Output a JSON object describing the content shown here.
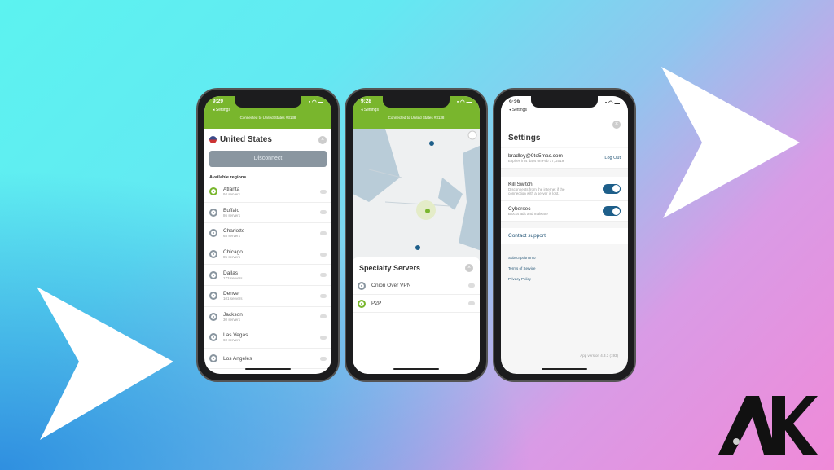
{
  "colors": {
    "accent_green": "#79b62d",
    "toggle_blue": "#1e5f8a",
    "arrow": "#ffffff"
  },
  "phone1": {
    "time": "9:29",
    "back": "◂ Settings",
    "connected": "Connected to United States #3138",
    "country": "United States",
    "flag_icon": "us-flag-icon",
    "disconnect": "Disconnect",
    "regions_title": "Available regions",
    "regions": [
      {
        "name": "Atlanta",
        "servers": "94 servers",
        "active": true
      },
      {
        "name": "Buffalo",
        "servers": "86 servers"
      },
      {
        "name": "Charlotte",
        "servers": "68 servers"
      },
      {
        "name": "Chicago",
        "servers": "85 servers"
      },
      {
        "name": "Dallas",
        "servers": "173 servers"
      },
      {
        "name": "Denver",
        "servers": "101 servers"
      },
      {
        "name": "Jackson",
        "servers": "30 servers"
      },
      {
        "name": "Las Vegas",
        "servers": "60 servers"
      },
      {
        "name": "Los Angeles",
        "servers": ""
      }
    ]
  },
  "phone2": {
    "time": "9:28",
    "back": "◂ Settings",
    "connected": "Connected to United States #3138",
    "sheet_title": "Specialty Servers",
    "items": [
      {
        "name": "Onion Over VPN"
      },
      {
        "name": "P2P",
        "active": true
      }
    ]
  },
  "phone3": {
    "time": "9:29",
    "back": "◂ Settings",
    "title": "Settings",
    "email": "bradley@9to5mac.com",
    "expires": "Expires in 4 days on Feb 17, 2019",
    "logout": "Log Out",
    "kill_switch": {
      "label": "Kill Switch",
      "desc": "Disconnects from the internet if the connection with a server is lost.",
      "on": true
    },
    "cybersec": {
      "label": "Cybersec",
      "desc": "Blocks ads and malware",
      "on": true
    },
    "contact": "Contact support",
    "links": [
      "Subscription Info",
      "Terms of Service",
      "Privacy Policy"
    ],
    "version": "App version 4.3.3 (193)"
  },
  "logo": "AK"
}
